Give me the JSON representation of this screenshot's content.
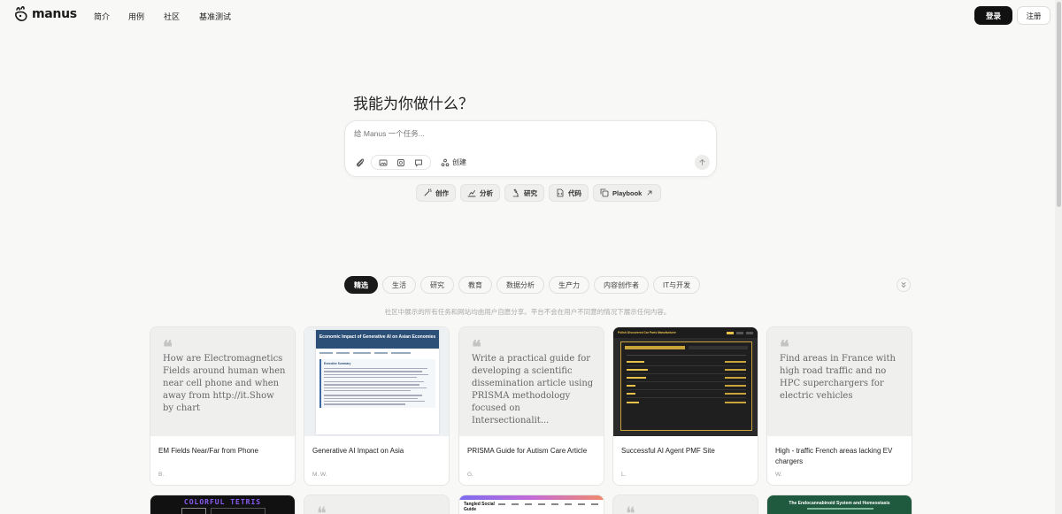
{
  "brand": {
    "name": "manus"
  },
  "nav": {
    "items": [
      "简介",
      "用例",
      "社区",
      "基准测试"
    ]
  },
  "auth": {
    "login": "登录",
    "register": "注册"
  },
  "hero": {
    "title": "我能为你做什么？",
    "input_placeholder": "给 Manus 一个任务...",
    "create_label": "创建"
  },
  "quick_actions": [
    "创作",
    "分析",
    "研究",
    "代码",
    "Playbook"
  ],
  "categories": [
    "精选",
    "生活",
    "研究",
    "教育",
    "数据分析",
    "生产力",
    "内容创作者",
    "IT与开发"
  ],
  "disclaimer": "社区中展示的所有任务和网站均由用户自愿分享。平台不会在用户不同意的情况下展示任何内容。",
  "cards": [
    {
      "quote": "How are Electromagnetics Fields around human when near cell phone and when away from http://it.Show by chart",
      "title": "EM Fields Near/Far from Phone",
      "author": "B."
    },
    {
      "preview_title": "Economic Impact of Generative AI on Asian Economies",
      "preview_section": "Executive Summary",
      "title": "Generative AI Impact on Asia",
      "author": "M. W."
    },
    {
      "quote": "Write a practical guide for developing a scientific dissemination article using PRISMA methodology focused on Intersectionalit...",
      "title": "PRISMA Guide for Autism Care Article",
      "author": "G."
    },
    {
      "preview_title": "Polish Discovered Car Parts Manufacturer",
      "title": "Successful AI Agent PMF Site",
      "author": "L."
    },
    {
      "quote": "Find areas in France with high road traffic and no HPC superchargers for electric vehicles",
      "title": "High - traffic French areas lacking EV chargers",
      "author": "W."
    }
  ],
  "cards_row2": [
    {
      "preview_title": "COLORFUL TETRIS"
    },
    {
      "preview_title": ""
    },
    {
      "preview_title": "Tangled Social Guide"
    },
    {
      "preview_title": ""
    },
    {
      "preview_title": "The Endocannabinoid System and Homeostasis"
    }
  ]
}
